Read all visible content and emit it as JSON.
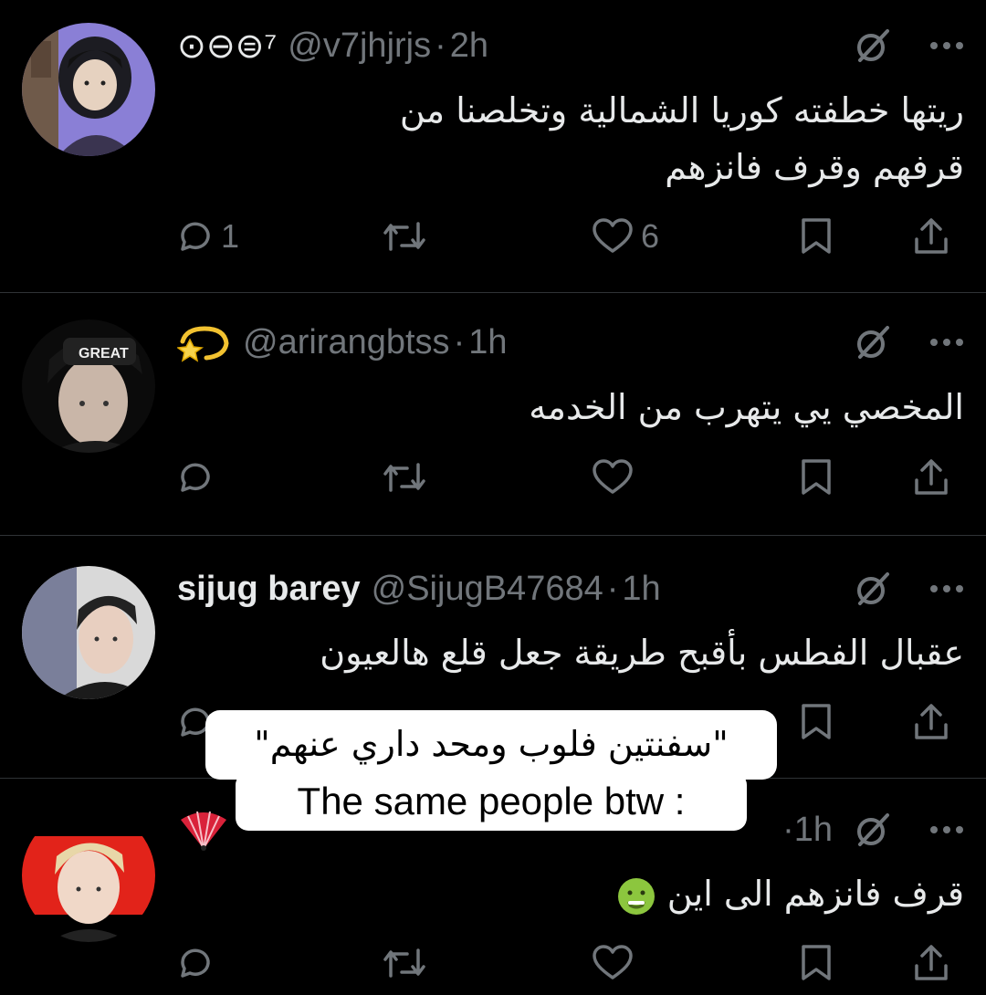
{
  "tweets": [
    {
      "display_name": "⊙⊖⊜⁷",
      "handle": "@v7jhjrjs",
      "time": "2h",
      "text_lines": [
        "ريتها خطفته كوريا الشمالية وتخلصنا من",
        "قرفهم وقرف فانزهم"
      ],
      "replies": "1",
      "likes": "6"
    },
    {
      "display_name": "",
      "handle": "@arirangbtss",
      "time": "1h",
      "text_lines": [
        "المخصي يي يتهرب من الخدمه"
      ],
      "replies": "",
      "likes": ""
    },
    {
      "display_name": "sijug barey",
      "handle": "@SijugB47684",
      "time": "1h",
      "text_lines": [
        "عقبال الفطس بأقبح طريقة جعل قلع هالعيون"
      ],
      "replies": "",
      "likes": ""
    },
    {
      "display_name": "",
      "handle": "",
      "time": "1h",
      "text_lines": [
        "قرف فانزهم الى اين"
      ],
      "replies": "",
      "likes": ""
    }
  ],
  "sep": "·",
  "captions": {
    "arabic": "\"سفنتين فلوب ومحد داري عنهم\"",
    "english": "The same people btw :"
  },
  "icons": {
    "reply": "reply-icon",
    "retweet": "retweet-icon",
    "like": "heart-icon",
    "bookmark": "bookmark-icon",
    "share": "share-icon",
    "grok": "grok-icon",
    "more": "more-icon",
    "dizzy": "dizzy-star-emoji",
    "fan": "folding-fan-emoji",
    "nauseated": "nauseated-face-emoji"
  },
  "colors": {
    "background": "#000000",
    "text": "#e7e9ea",
    "muted": "#71767b",
    "divider": "#2f3336",
    "caption_bg": "#ffffff"
  }
}
